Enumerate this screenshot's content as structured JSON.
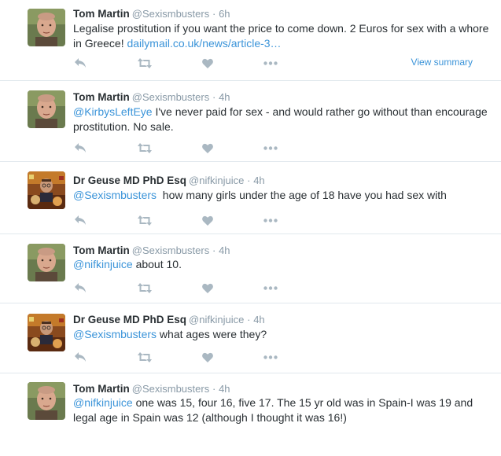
{
  "tweets": [
    {
      "name": "Tom Martin",
      "handle": "@Sexismbusters",
      "dot": "·",
      "time": "6h",
      "text_plain": "Legalise prostitution if you want the price to come down. 2 Euros for sex with a whore in Greece! ",
      "link": "dailymail.co.uk/news/article-3…",
      "summary": "View summary",
      "avatar": "tom-avatar"
    },
    {
      "name": "Tom Martin",
      "handle": "@Sexismbusters",
      "dot": "·",
      "time": "4h",
      "mention": "@KirbysLeftEye",
      "text_plain": " I've never paid for sex - and would rather go without than encourage prostitution. No sale.",
      "avatar": "tom-avatar"
    },
    {
      "name": "Dr Geuse MD PhD Esq",
      "handle": "@nifkinjuice",
      "dot": "·",
      "time": "4h",
      "mention": "@Sexismbusters",
      "text_plain": "  how many girls under the age of 18 have you had sex with",
      "avatar": "geuse-avatar"
    },
    {
      "name": "Tom Martin",
      "handle": "@Sexismbusters",
      "dot": "·",
      "time": "4h",
      "mention": "@nifkinjuice",
      "text_plain": " about 10.",
      "avatar": "tom-avatar"
    },
    {
      "name": "Dr Geuse MD PhD Esq",
      "handle": "@nifkinjuice",
      "dot": "·",
      "time": "4h",
      "mention": "@Sexismbusters",
      "text_plain": " what ages were they?",
      "avatar": "geuse-avatar"
    },
    {
      "name": "Tom Martin",
      "handle": "@Sexismbusters",
      "dot": "·",
      "time": "4h",
      "mention": "@nifkinjuice",
      "text_plain": " one was 15, four 16, five 17. The 15 yr old was in Spain-I was 19 and legal age in Spain was 12 (although I thought it was 16!)",
      "avatar": "tom-avatar"
    }
  ],
  "colors": {
    "link": "#3b94d9",
    "muted": "#8899a6",
    "text": "#292f33",
    "icon": "#aab8c2",
    "divider": "#e1e8ed"
  },
  "icons": {
    "reply": "reply-icon",
    "retweet": "retweet-icon",
    "like": "heart-icon",
    "more": "more-icon"
  }
}
